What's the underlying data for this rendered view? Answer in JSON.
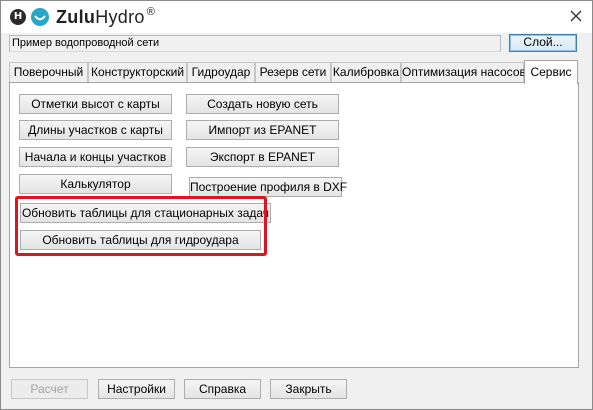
{
  "app": {
    "brand_bold": "Zulu",
    "brand_regular": "Hydro",
    "trademark": "®"
  },
  "header": {
    "network_name": "Пример водопроводной сети",
    "layer_button": "Слой..."
  },
  "tabs": [
    {
      "label": "Поверочный",
      "active": false
    },
    {
      "label": "Конструкторский",
      "active": false
    },
    {
      "label": "Гидроудар",
      "active": false
    },
    {
      "label": "Резерв сети",
      "active": false
    },
    {
      "label": "Калибровка",
      "active": false
    },
    {
      "label": "Оптимизация насосов",
      "active": false
    },
    {
      "label": "Сервис",
      "active": true
    }
  ],
  "service": {
    "left_buttons": [
      "Отметки высот с карты",
      "Длины участков с карты",
      "Начала и концы участков",
      "Калькулятор"
    ],
    "right_buttons": [
      "Создать новую сеть",
      "Импорт из EPANET",
      "Экспорт в EPANET",
      "Построение профиля в DXF"
    ],
    "update_buttons": [
      "Обновить таблицы для стационарных задач",
      "Обновить таблицы для гидроудара"
    ]
  },
  "footer": {
    "calculate": "Расчет",
    "settings": "Настройки",
    "help": "Справка",
    "close": "Закрыть"
  },
  "colors": {
    "highlight": "#e0141e",
    "logo_accent": "#2aa6c8",
    "window_bg": "#f0f0f0"
  }
}
